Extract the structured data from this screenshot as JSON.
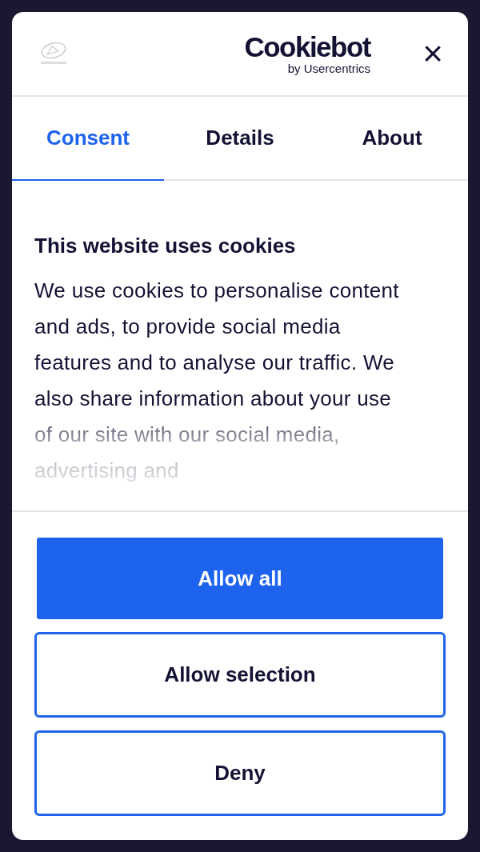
{
  "header": {
    "brand": {
      "name": "Cookiebot",
      "tagline": "by Usercentrics"
    },
    "close": "×"
  },
  "tabs": [
    {
      "label": "Consent",
      "selected": true
    },
    {
      "label": "Details",
      "selected": false
    },
    {
      "label": "About",
      "selected": false
    }
  ],
  "content": {
    "title": "This website uses cookies",
    "body": "We use cookies to personalise content and ads, to provide social media features and to analyse our traffic. We also share information about your use of our site with our social media, advertising and"
  },
  "buttons": [
    {
      "label": "Allow all",
      "kind": "primary"
    },
    {
      "label": "Allow selection",
      "kind": "outline"
    },
    {
      "label": "Deny",
      "kind": "outline"
    }
  ]
}
